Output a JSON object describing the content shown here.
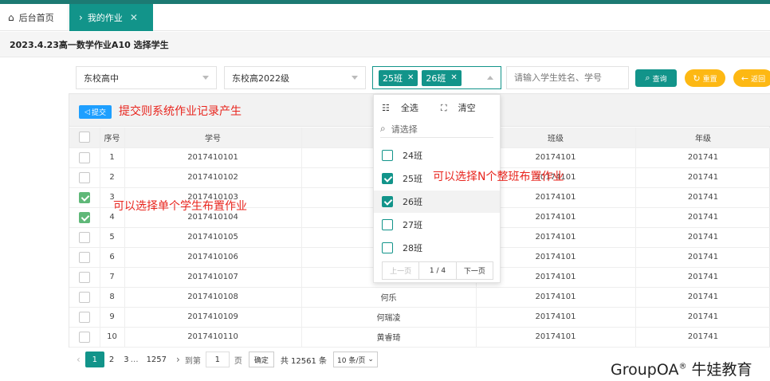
{
  "tabs": {
    "home": "后台首页",
    "active": "我的作业"
  },
  "crumb": "2023.4.23高一数学作业A10 选择学生",
  "filters": {
    "campus": "东校高中",
    "grade": "东校高2022级",
    "chips": [
      "25班",
      "26班"
    ],
    "search_placeholder": "请输入学生姓名、学号"
  },
  "buttons": {
    "query": "查询",
    "reset": "重置",
    "back": "返回"
  },
  "toolbar": {
    "submit": "提交"
  },
  "annotations": {
    "submit_note": "提交则系统作业记录产生",
    "class_note": "可以选择N个整班布置作业",
    "student_note": "可以选择单个学生布置作业"
  },
  "table": {
    "headers": {
      "index": "序号",
      "student_id": "学号",
      "class": "班级",
      "grade": "年级"
    },
    "rows": [
      {
        "index": "1",
        "checked": false,
        "student_id": "2017410101",
        "name": "",
        "class": "20174101",
        "grade": "201741"
      },
      {
        "index": "2",
        "checked": false,
        "student_id": "2017410102",
        "name": "",
        "class": "20174101",
        "grade": "201741"
      },
      {
        "index": "3",
        "checked": true,
        "student_id": "2017410103",
        "name": "",
        "class": "20174101",
        "grade": "201741"
      },
      {
        "index": "4",
        "checked": true,
        "student_id": "2017410104",
        "name": "",
        "class": "20174101",
        "grade": "201741"
      },
      {
        "index": "5",
        "checked": false,
        "student_id": "2017410105",
        "name": "",
        "class": "20174101",
        "grade": "201741"
      },
      {
        "index": "6",
        "checked": false,
        "student_id": "2017410106",
        "name": "",
        "class": "20174101",
        "grade": "201741"
      },
      {
        "index": "7",
        "checked": false,
        "student_id": "2017410107",
        "name": "",
        "class": "20174101",
        "grade": "201741"
      },
      {
        "index": "8",
        "checked": false,
        "student_id": "2017410108",
        "name": "何乐",
        "class": "20174101",
        "grade": "201741"
      },
      {
        "index": "9",
        "checked": false,
        "student_id": "2017410109",
        "name": "何瑞凌",
        "class": "20174101",
        "grade": "201741"
      },
      {
        "index": "10",
        "checked": false,
        "student_id": "2017410110",
        "name": "黄睿琦",
        "class": "20174101",
        "grade": "201741"
      }
    ]
  },
  "dropdown": {
    "select_all": "全选",
    "clear": "清空",
    "search_placeholder": "请选择",
    "options": [
      {
        "label": "24班",
        "checked": false
      },
      {
        "label": "25班",
        "checked": true
      },
      {
        "label": "26班",
        "checked": true
      },
      {
        "label": "27班",
        "checked": false
      },
      {
        "label": "28班",
        "checked": false
      }
    ],
    "prev": "上一页",
    "page": "1 / 4",
    "next": "下一页"
  },
  "pager": {
    "pages": [
      "1",
      "2",
      "3"
    ],
    "ellipsis": "…",
    "last": "1257",
    "goto_label": "到第",
    "goto_value": "1",
    "page_unit": "页",
    "confirm": "确定",
    "total": "共 12561 条",
    "page_size": "10 条/页"
  },
  "brand": {
    "name": "GroupOA",
    "reg": "®",
    "suffix": "牛娃教育"
  },
  "colors": {
    "primary": "#12948a",
    "warning": "#fdb813",
    "annotation": "#e8251e",
    "submit": "#1e9fff"
  }
}
